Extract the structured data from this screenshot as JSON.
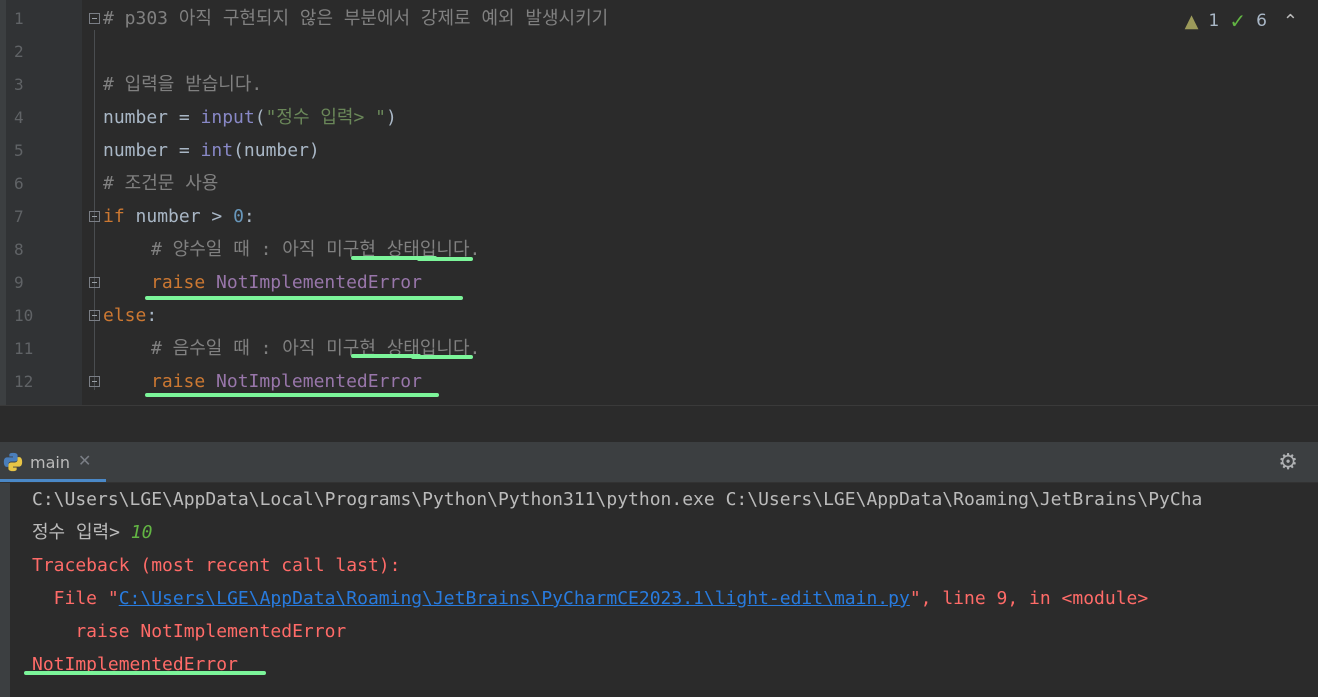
{
  "editor": {
    "inspections": {
      "warnings": "1",
      "checks": "6"
    },
    "lines": [
      {
        "n": "1",
        "comment": "# p303 아직 구현되지 않은 부분에서 강제로 예외 발생시키기"
      },
      {
        "n": "2"
      },
      {
        "n": "3",
        "comment": "# 입력을 받습니다."
      },
      {
        "n": "4",
        "var": "number",
        "op": " = ",
        "fn": "input",
        "open": "(",
        "str": "\"정수 입력> \"",
        "close": ")"
      },
      {
        "n": "5",
        "var": "number",
        "op": " = ",
        "fn": "int",
        "args": "(number)"
      },
      {
        "n": "6",
        "comment": "# 조건문 사용"
      },
      {
        "n": "7",
        "kw": "if",
        "rest1": " number > ",
        "num": "0",
        "rest2": ":"
      },
      {
        "n": "8",
        "comment": "# 양수일 때 : 아직 미구현 상태입니다."
      },
      {
        "n": "9",
        "kw": "raise",
        "cls": "NotImplementedError"
      },
      {
        "n": "10",
        "kw": "else",
        "rest2": ":"
      },
      {
        "n": "11",
        "comment": "# 음수일 때 : 아직 미구현 상태입니다."
      },
      {
        "n": "12",
        "kw": "raise",
        "cls": "NotImplementedError"
      }
    ]
  },
  "run": {
    "tab_label": "main",
    "console": {
      "cmd": "C:\\Users\\LGE\\AppData\\Local\\Programs\\Python\\Python311\\python.exe C:\\Users\\LGE\\AppData\\Roaming\\JetBrains\\PyCha",
      "prompt": "정수 입력> ",
      "input_value": "10",
      "traceback": "Traceback (most recent call last):",
      "file_prefix": "  File \"",
      "file_link": "C:\\Users\\LGE\\AppData\\Roaming\\JetBrains\\PyCharmCE2023.1\\light-edit\\main.py",
      "file_suffix": "\", line 9, in <module>",
      "raise_line": "    raise NotImplementedError",
      "error": "NotImplementedError"
    }
  },
  "colors": {
    "background": "#2b2b2b",
    "keyword": "#cc7832",
    "string": "#6a8759",
    "error": "#ff6b68",
    "link": "#287bde",
    "annotation_underline": "#7cf59a"
  }
}
